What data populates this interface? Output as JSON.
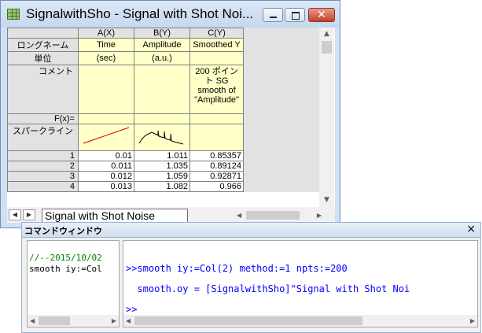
{
  "worksheet": {
    "title": "SignalwithSho - Signal with Shot Noi...",
    "close_label": "✕",
    "columns": [
      {
        "header": "A(X)",
        "long_name": "Time",
        "units": "(sec)",
        "comment": ""
      },
      {
        "header": "B(Y)",
        "long_name": "Amplitude",
        "units": "(a.u.)",
        "comment": ""
      },
      {
        "header": "C(Y)",
        "long_name": "Smoothed Y",
        "units": "",
        "comment": "200 ポイント SG smooth of \"Amplitude\""
      }
    ],
    "row_labels": {
      "long_name": "ロングネーム",
      "units": "単位",
      "comment": "コメント",
      "formula": "F(x)=",
      "sparkline": "スパークライン"
    },
    "rows": [
      {
        "index": "1",
        "a": "0.01",
        "b": "1.011",
        "c": "0.85357"
      },
      {
        "index": "2",
        "a": "0.011",
        "b": "1.035",
        "c": "0.89124"
      },
      {
        "index": "3",
        "a": "0.012",
        "b": "1.059",
        "c": "0.92871"
      },
      {
        "index": "4",
        "a": "0.013",
        "b": "1.082",
        "c": "0.966"
      }
    ],
    "sheet_tab": "Signal with Shot Noise"
  },
  "command_window": {
    "title": "コマンドウィンドウ",
    "close_label": "×",
    "history": [
      "//--2015/10/02",
      "smooth iy:=Col"
    ],
    "console_lines": [
      ">>smooth iy:=Col(2) method:=1 npts:=200",
      "  smooth.oy = [SignalwithSho]\"Signal with Shot Noi",
      ">>"
    ]
  },
  "colors": {
    "meta_cell": "#ffffc8",
    "header_cell": "#e2e2e2",
    "console_text": "#0000ff",
    "history_comment": "#008000"
  }
}
